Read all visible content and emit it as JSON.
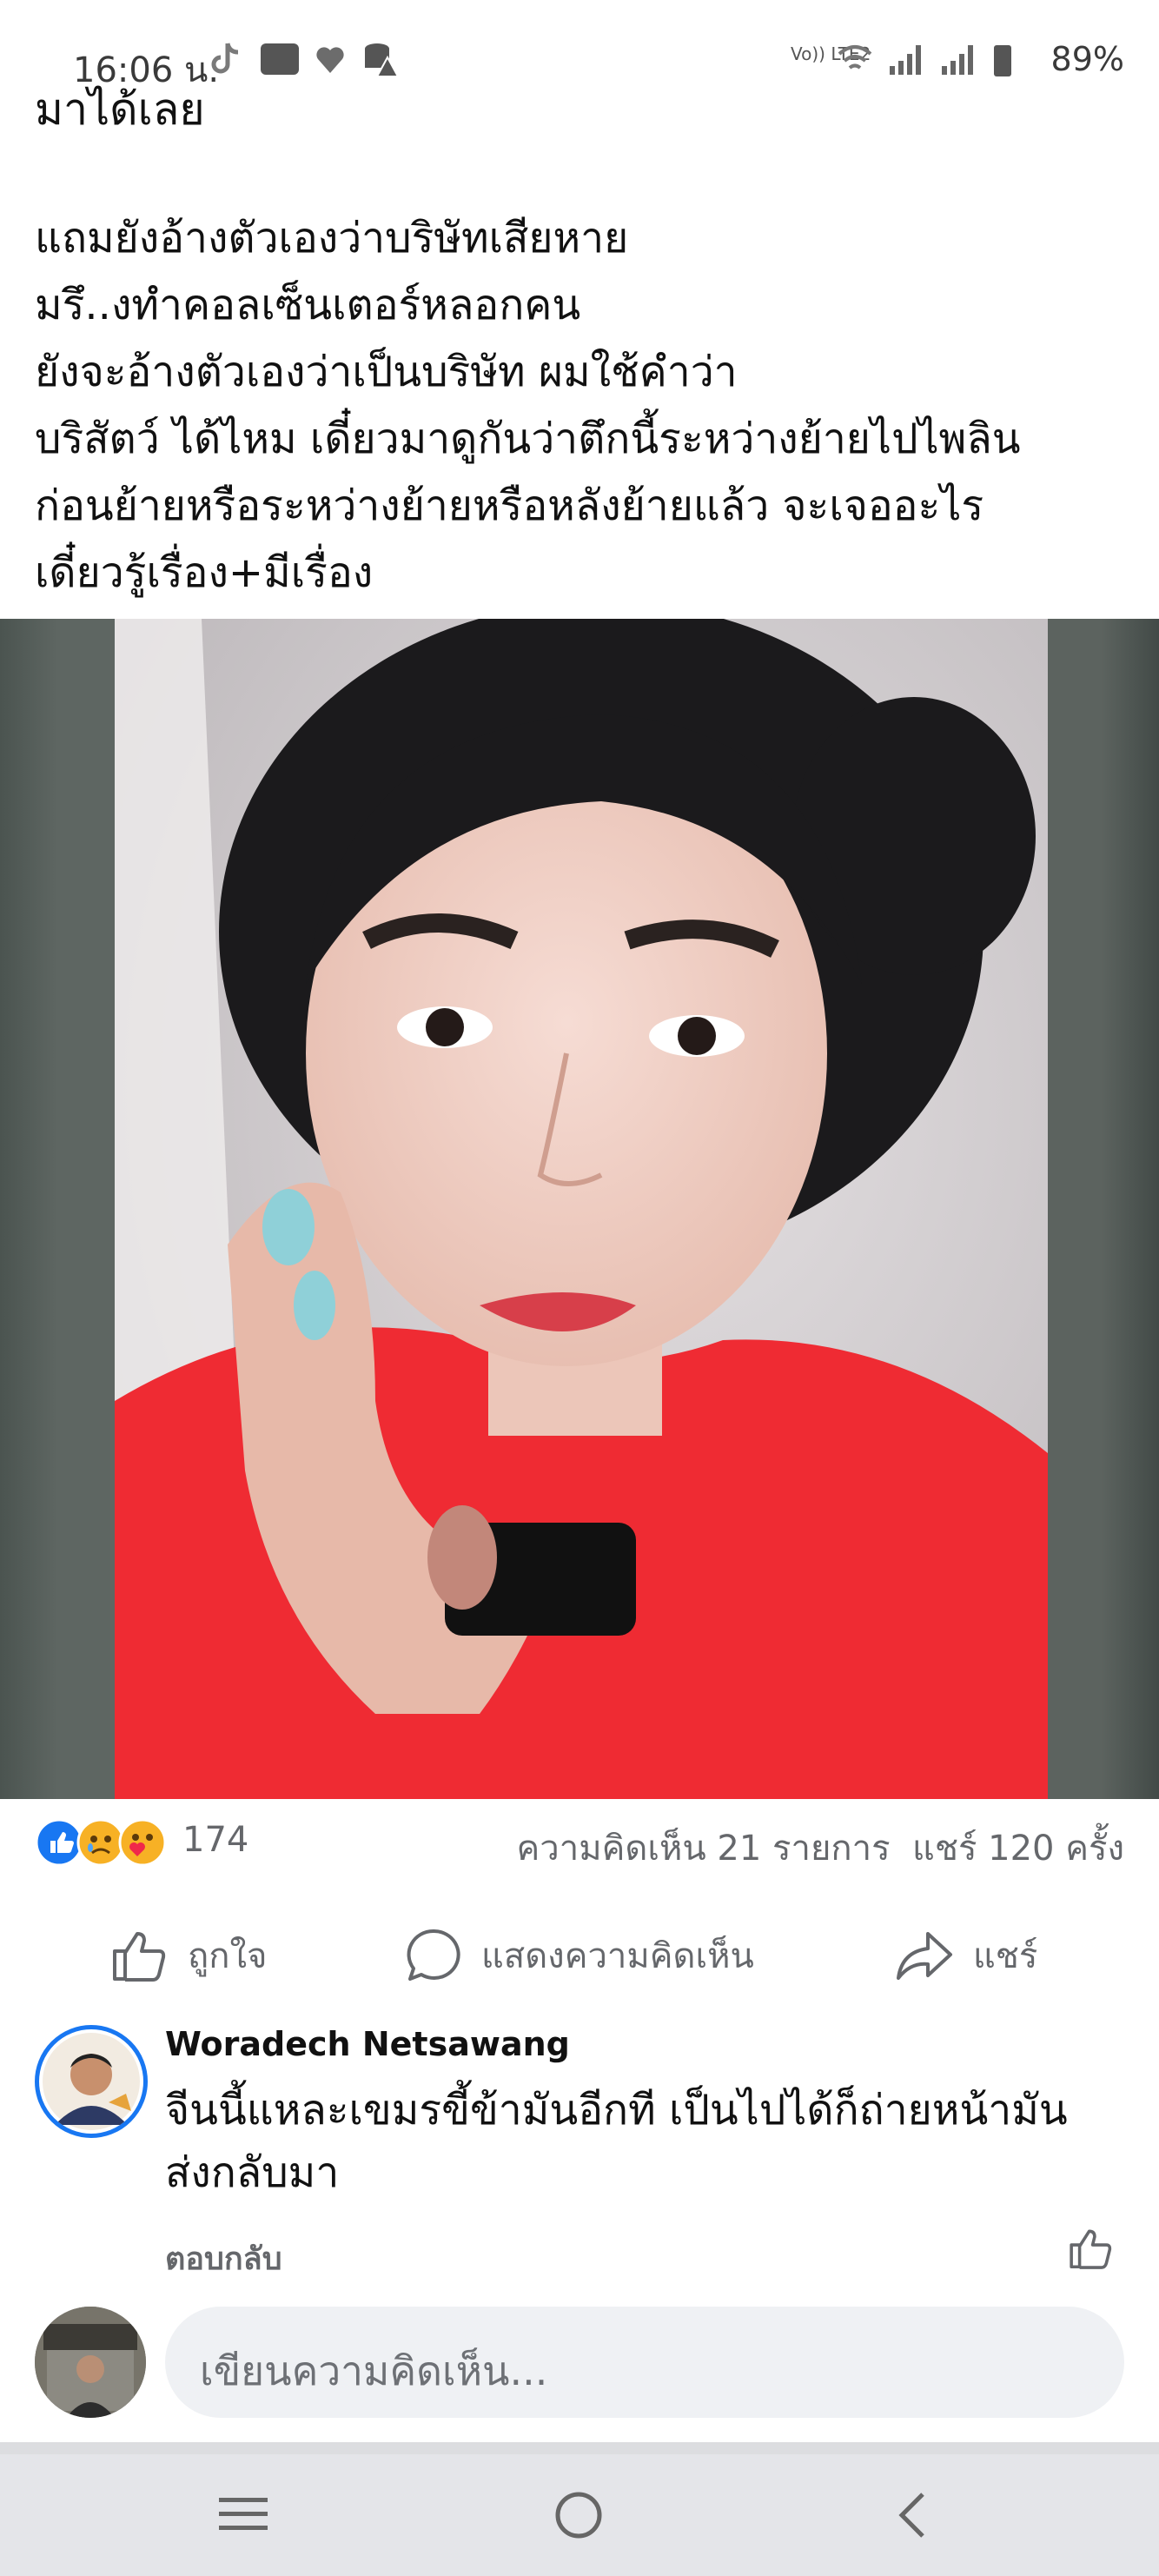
{
  "status_bar": {
    "time": "16:06 น.",
    "battery": "89%",
    "network": "Vo)) LTE2"
  },
  "post": {
    "partial_line": "มาได้เลย",
    "lines": [
      "แถมยังอ้างตัวเองว่าบริษัทเสียหาย",
      "มรึ..งทำคอลเซ็นเตอร์หลอกคน",
      "ยังจะอ้างตัวเองว่าเป็นบริษัท  ผมใช้คำว่า",
      "บริสัตว์ ได้ไหม  เดี๋ยวมาดูกันว่าตึกนี้ระหว่างย้ายไปไพลิน",
      "ก่อนย้ายหรือระหว่างย้ายหรือหลังย้ายแล้ว จะเจออะไร",
      "เดี๋ยวรู้เรื่อง+มีเรื่อง"
    ]
  },
  "reactions": {
    "count": "174",
    "comments": "ความคิดเห็น 21 รายการ",
    "shares": "แชร์ 120 ครั้ง",
    "icons": [
      "like-icon",
      "sad-icon",
      "care-icon"
    ]
  },
  "actions": {
    "like": "ถูกใจ",
    "comment": "แสดงความคิดเห็น",
    "share": "แชร์"
  },
  "comment": {
    "author": "Woradech Netsawang",
    "text_lines": [
      "จีนนี้แหละเขมรขี้ข้ามันอีกที เป็นไปได้ก็ถ่ายหน้ามัน",
      "ส่งกลับมา"
    ],
    "reply_label": "ตอบกลับ"
  },
  "composer": {
    "placeholder": "เขียนความคิดเห็น..."
  },
  "colors": {
    "fb_blue": "#1877f2",
    "secondary_text": "#65676b",
    "shirt_red": "#ef2b33"
  }
}
